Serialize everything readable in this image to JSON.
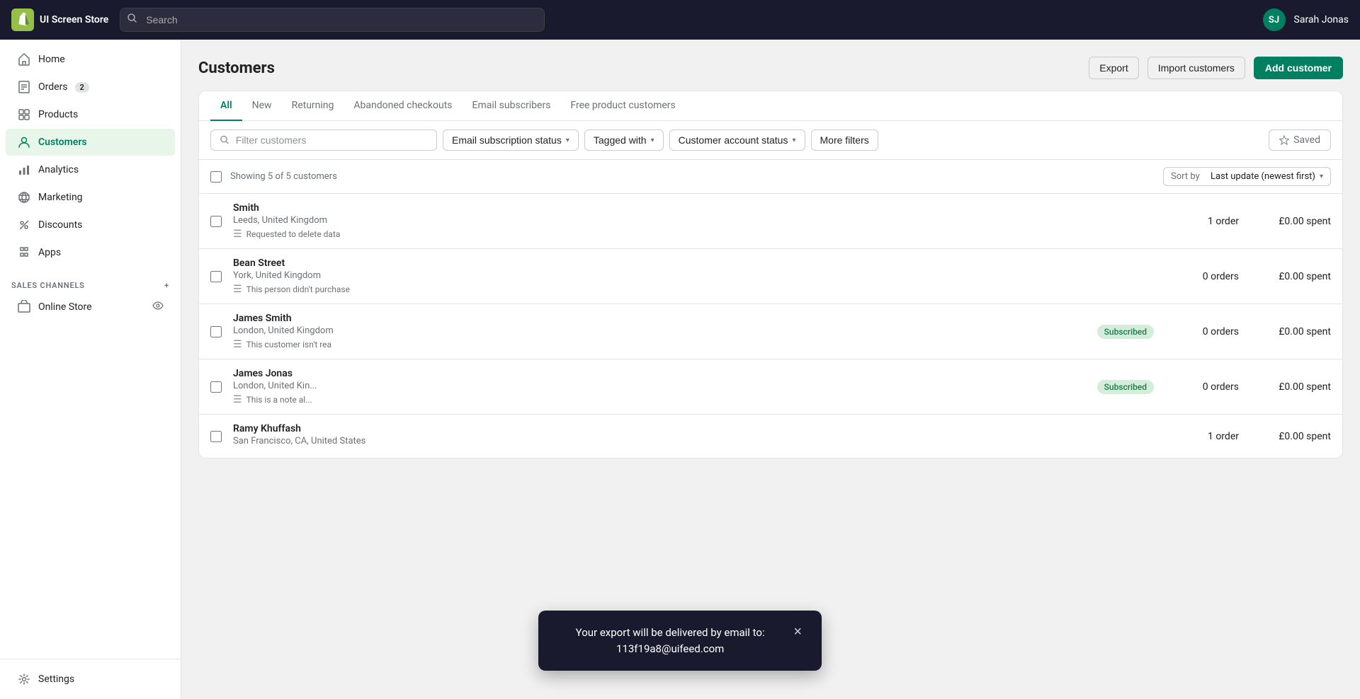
{
  "topBar": {
    "storeName": "UI Screen Store",
    "searchPlaceholder": "Search",
    "user": {
      "initials": "SJ",
      "name": "Sarah Jonas"
    }
  },
  "sidebar": {
    "navItems": [
      {
        "id": "home",
        "label": "Home",
        "icon": "home"
      },
      {
        "id": "orders",
        "label": "Orders",
        "icon": "orders",
        "badge": "2"
      },
      {
        "id": "products",
        "label": "Products",
        "icon": "products"
      },
      {
        "id": "customers",
        "label": "Customers",
        "icon": "customers",
        "active": true
      },
      {
        "id": "analytics",
        "label": "Analytics",
        "icon": "analytics"
      },
      {
        "id": "marketing",
        "label": "Marketing",
        "icon": "marketing"
      },
      {
        "id": "discounts",
        "label": "Discounts",
        "icon": "discounts"
      },
      {
        "id": "apps",
        "label": "Apps",
        "icon": "apps"
      }
    ],
    "salesChannelsLabel": "SALES CHANNELS",
    "salesChannels": [
      {
        "id": "online-store",
        "label": "Online Store",
        "icon": "online-store"
      }
    ],
    "settingsLabel": "Settings"
  },
  "page": {
    "title": "Customers",
    "exportLabel": "Export",
    "importLabel": "Import customers",
    "addLabel": "Add customer"
  },
  "tabs": [
    {
      "id": "all",
      "label": "All",
      "active": true
    },
    {
      "id": "new",
      "label": "New"
    },
    {
      "id": "returning",
      "label": "Returning"
    },
    {
      "id": "abandoned",
      "label": "Abandoned checkouts"
    },
    {
      "id": "email-sub",
      "label": "Email subscribers"
    },
    {
      "id": "free-product",
      "label": "Free product customers"
    }
  ],
  "filters": {
    "searchPlaceholder": "Filter customers",
    "emailSubLabel": "Email subscription status",
    "taggedWithLabel": "Tagged with",
    "accountStatusLabel": "Customer account status",
    "moreFiltersLabel": "More filters",
    "savedLabel": "Saved"
  },
  "table": {
    "showingText": "Showing 5 of 5 customers",
    "sortLabel": "Sort by",
    "sortValue": "Last update (newest first)",
    "customers": [
      {
        "name": "Smith",
        "location": "Leeds, United Kingdom",
        "note": "Requested to delete data",
        "badge": null,
        "orders": "1 order",
        "spent": "£0.00 spent"
      },
      {
        "name": "Bean Street",
        "location": "York, United Kingdom",
        "note": "This person didn't purchase",
        "badge": null,
        "orders": "0 orders",
        "spent": "£0.00 spent"
      },
      {
        "name": "James Smith",
        "location": "London, United Kingdom",
        "note": "This customer isn't rea",
        "badge": "Subscribed",
        "orders": "0 orders",
        "spent": "£0.00 spent"
      },
      {
        "name": "James Jonas",
        "location": "London, United Kin...",
        "note": "This is a note al...",
        "badge": "Subscribed",
        "orders": "0 orders",
        "spent": "£0.00 spent"
      },
      {
        "name": "Ramy Khuffash",
        "location": "San Francisco, CA, United States",
        "note": "",
        "badge": null,
        "orders": "1 order",
        "spent": "£0.00 spent"
      }
    ]
  },
  "toast": {
    "line1": "Your export will be delivered by email to:",
    "line2": "113f19a8@uifeed.com",
    "closeLabel": "×"
  }
}
